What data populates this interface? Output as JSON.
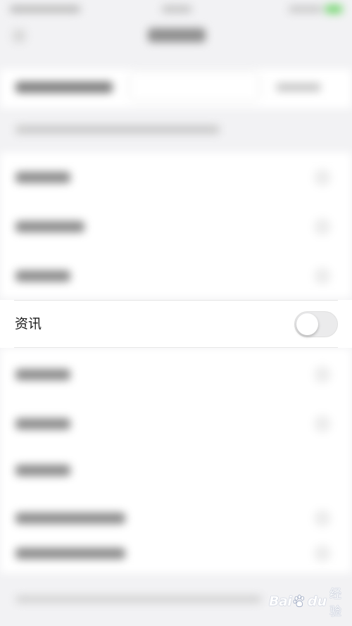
{
  "focused_setting": {
    "label": "资讯",
    "toggle_on": false
  },
  "watermark": {
    "brand_latin": "Bai",
    "brand_du": "du",
    "brand_cn": "经验"
  },
  "colors": {
    "background": "#f2f2f4",
    "row_background": "#ffffff",
    "toggle_off_track": "#ebebec",
    "battery_green": "#76d672"
  },
  "icons": [
    "back-arrow-icon",
    "chevron-right-icon",
    "battery-icon",
    "baidu-paw-icon"
  ]
}
